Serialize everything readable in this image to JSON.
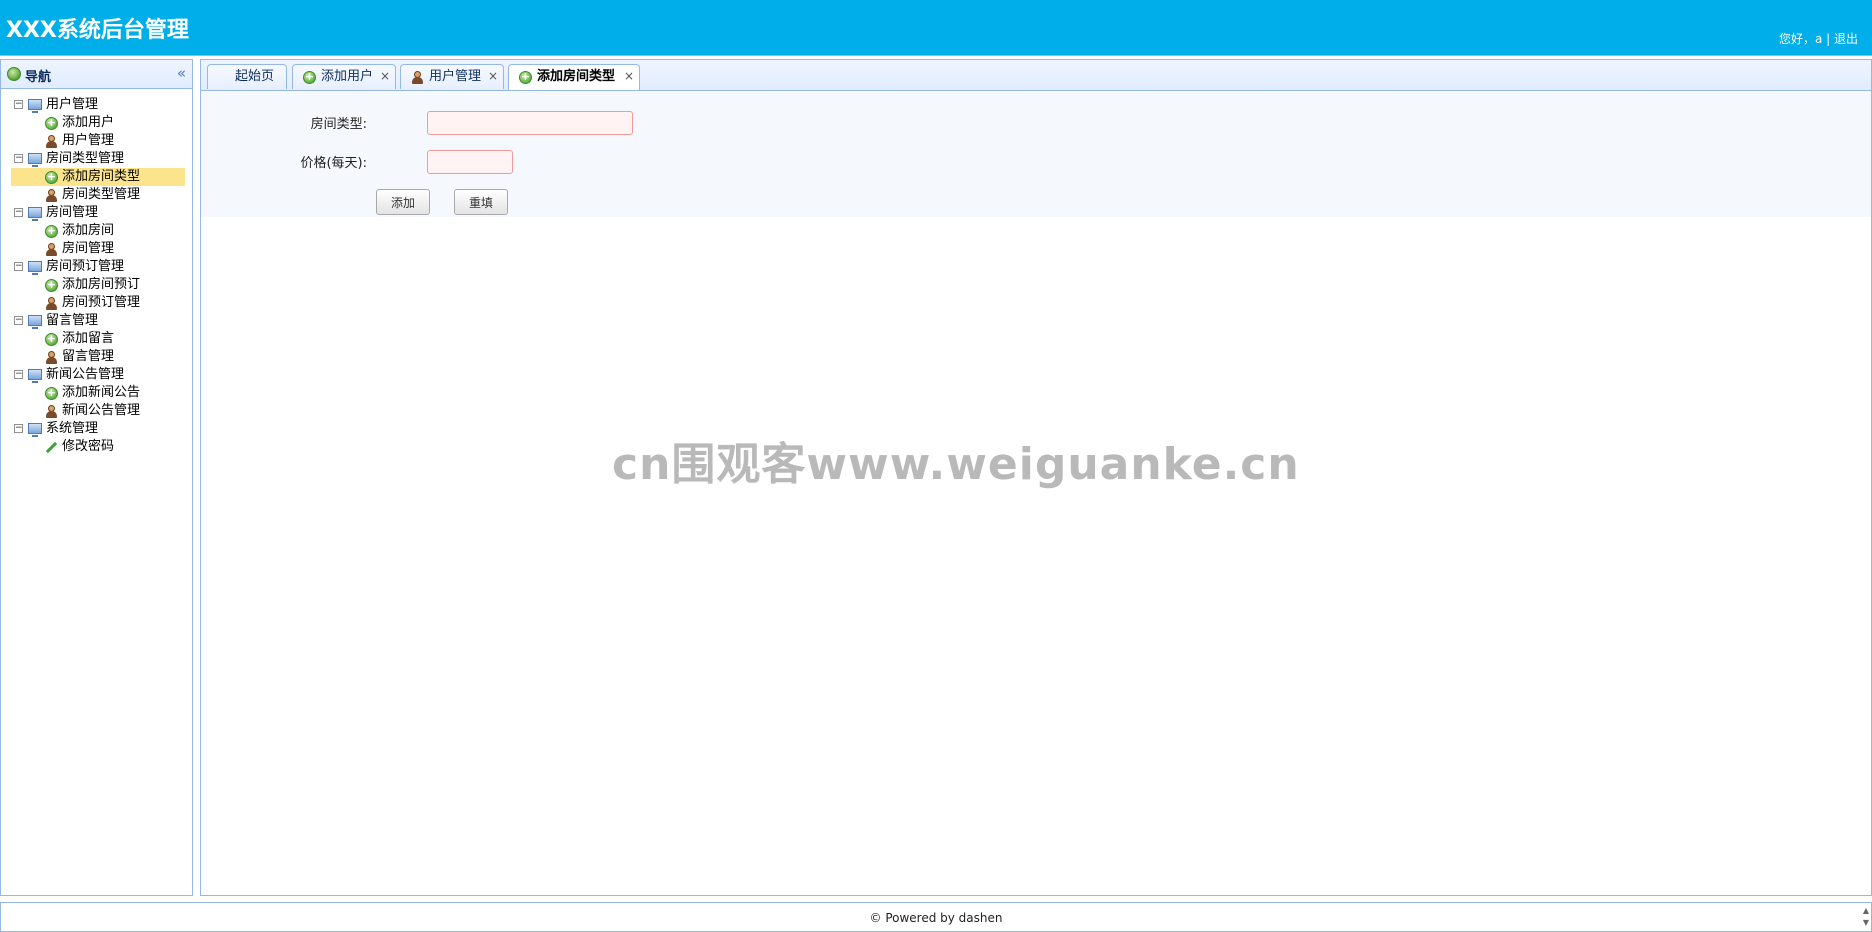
{
  "header": {
    "title": "XXX系统后台管理",
    "greeting": "您好，a",
    "separator": " | ",
    "logout": "退出",
    "bg_color": "#00aeea"
  },
  "sidebar": {
    "title": "导航",
    "collapse_icon": "double-chevron-left-icon",
    "groups": [
      {
        "label": "用户管理",
        "items": [
          {
            "label": "添加用户",
            "icon": "add-icon"
          },
          {
            "label": "用户管理",
            "icon": "user-icon"
          }
        ]
      },
      {
        "label": "房间类型管理",
        "items": [
          {
            "label": "添加房间类型",
            "icon": "add-icon",
            "selected": true
          },
          {
            "label": "房间类型管理",
            "icon": "user-icon"
          }
        ]
      },
      {
        "label": "房间管理",
        "items": [
          {
            "label": "添加房间",
            "icon": "add-icon"
          },
          {
            "label": "房间管理",
            "icon": "user-icon"
          }
        ]
      },
      {
        "label": "房间预订管理",
        "items": [
          {
            "label": "添加房间预订",
            "icon": "add-icon"
          },
          {
            "label": "房间预订管理",
            "icon": "user-icon"
          }
        ]
      },
      {
        "label": "留言管理",
        "items": [
          {
            "label": "添加留言",
            "icon": "add-icon"
          },
          {
            "label": "留言管理",
            "icon": "user-icon"
          }
        ]
      },
      {
        "label": "新闻公告管理",
        "items": [
          {
            "label": "添加新闻公告",
            "icon": "add-icon"
          },
          {
            "label": "新闻公告管理",
            "icon": "user-icon"
          }
        ]
      },
      {
        "label": "系统管理",
        "items": [
          {
            "label": "修改密码",
            "icon": "pencil-icon"
          }
        ]
      }
    ]
  },
  "tabs": [
    {
      "label": "起始页",
      "closable": false
    },
    {
      "label": "添加用户",
      "closable": true,
      "icon": "add-icon"
    },
    {
      "label": "用户管理",
      "closable": true,
      "icon": "user-icon"
    },
    {
      "label": "添加房间类型",
      "closable": true,
      "icon": "add-icon",
      "active": true
    }
  ],
  "tab_close_glyph": "×",
  "form": {
    "room_type_label": "房间类型:",
    "room_type_value": "",
    "price_label": "价格(每天):",
    "price_value": "",
    "add_button": "添加",
    "reset_button": "重填"
  },
  "watermark": "cn围观客www.weiguanke.cn",
  "footer": {
    "text": "© Powered by dashen"
  }
}
